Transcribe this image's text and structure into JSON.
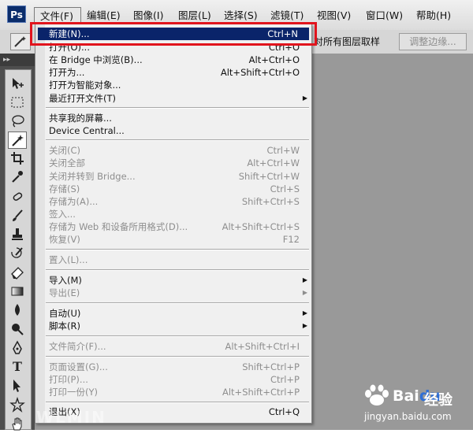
{
  "app": {
    "logo": "Ps"
  },
  "menubar": {
    "items": [
      {
        "label": "文件(F)"
      },
      {
        "label": "编辑(E)"
      },
      {
        "label": "图像(I)"
      },
      {
        "label": "图层(L)"
      },
      {
        "label": "选择(S)"
      },
      {
        "label": "滤镜(T)"
      },
      {
        "label": "视图(V)"
      },
      {
        "label": "窗口(W)"
      },
      {
        "label": "帮助(H)"
      }
    ]
  },
  "options_bar": {
    "sample_text": "对所有图层取样",
    "refine_edge_button": "调整边缘..."
  },
  "file_menu": {
    "items": [
      {
        "label": "新建(N)...",
        "shortcut": "Ctrl+N",
        "enabled": true,
        "highlighted": true
      },
      {
        "label": "打开(O)...",
        "shortcut": "Ctrl+O",
        "enabled": true
      },
      {
        "label": "在 Bridge 中浏览(B)...",
        "shortcut": "Alt+Ctrl+O",
        "enabled": true
      },
      {
        "label": "打开为...",
        "shortcut": "Alt+Shift+Ctrl+O",
        "enabled": true
      },
      {
        "label": "打开为智能对象...",
        "shortcut": "",
        "enabled": true
      },
      {
        "label": "最近打开文件(T)",
        "shortcut": "",
        "enabled": true,
        "submenu": true
      },
      {
        "label": "共享我的屏幕...",
        "shortcut": "",
        "enabled": true
      },
      {
        "label": "Device Central...",
        "shortcut": "",
        "enabled": true
      },
      {
        "label": "关闭(C)",
        "shortcut": "Ctrl+W",
        "enabled": false
      },
      {
        "label": "关闭全部",
        "shortcut": "Alt+Ctrl+W",
        "enabled": false
      },
      {
        "label": "关闭并转到 Bridge...",
        "shortcut": "Shift+Ctrl+W",
        "enabled": false
      },
      {
        "label": "存储(S)",
        "shortcut": "Ctrl+S",
        "enabled": false
      },
      {
        "label": "存储为(A)...",
        "shortcut": "Shift+Ctrl+S",
        "enabled": false
      },
      {
        "label": "签入...",
        "shortcut": "",
        "enabled": false
      },
      {
        "label": "存储为 Web 和设备所用格式(D)...",
        "shortcut": "Alt+Shift+Ctrl+S",
        "enabled": false
      },
      {
        "label": "恢复(V)",
        "shortcut": "F12",
        "enabled": false
      },
      {
        "label": "置入(L)...",
        "shortcut": "",
        "enabled": false
      },
      {
        "label": "导入(M)",
        "shortcut": "",
        "enabled": true,
        "submenu": true
      },
      {
        "label": "导出(E)",
        "shortcut": "",
        "enabled": false,
        "submenu": true
      },
      {
        "label": "自动(U)",
        "shortcut": "",
        "enabled": true,
        "submenu": true
      },
      {
        "label": "脚本(R)",
        "shortcut": "",
        "enabled": true,
        "submenu": true
      },
      {
        "label": "文件简介(F)...",
        "shortcut": "Alt+Shift+Ctrl+I",
        "enabled": false
      },
      {
        "label": "页面设置(G)...",
        "shortcut": "Shift+Ctrl+P",
        "enabled": false
      },
      {
        "label": "打印(P)...",
        "shortcut": "Ctrl+P",
        "enabled": false
      },
      {
        "label": "打印一份(Y)",
        "shortcut": "Alt+Shift+Ctrl+P",
        "enabled": false
      },
      {
        "label": "退出(X)",
        "shortcut": "Ctrl+Q",
        "enabled": true
      }
    ]
  },
  "watermark": {
    "left_text": "WLMIN",
    "brand_bai": "Bai",
    "brand_du": "du",
    "brand_jingyan": "经验",
    "url": "jingyan.baidu.com"
  },
  "colors": {
    "highlight": "#0a246a",
    "annotation_red": "#e1141d",
    "workspace": "#999999"
  }
}
